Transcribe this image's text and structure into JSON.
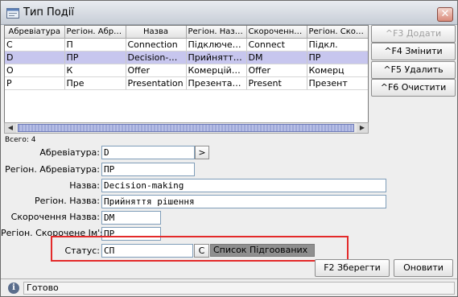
{
  "window": {
    "title": "Тип Події"
  },
  "table": {
    "columns": [
      "Абревіатура",
      "Регіон. Абреві...",
      "Назва",
      "Регіон. Назва",
      "Скорочення ...",
      "Регіон. Скоро..."
    ],
    "rows": [
      [
        "С",
        "П",
        "Connection",
        "Підключення",
        "Connect",
        "Підкл."
      ],
      [
        "D",
        "ПР",
        "Decision-ma...",
        "Прийняття ...",
        "DM",
        "ПР"
      ],
      [
        "O",
        "К",
        "Offer",
        "Комерційна ...",
        "Offer",
        "Комерц"
      ],
      [
        "P",
        "Пре",
        "Presentation",
        "Презентаці...",
        "Present",
        "Презент"
      ]
    ],
    "selected_row": 1,
    "total_label": "Всего: 4"
  },
  "side_buttons": {
    "add": "^F3 Додати",
    "edit": "^F4 Змінити",
    "delete": "^F5 Удалить",
    "clear": "^F6 Очистити"
  },
  "form": {
    "abbr_label": "Абревіатура:",
    "abbr_value": "D",
    "abbr_button": ">",
    "region_abbr_label": "Регіон. Абревіатура:",
    "region_abbr_value": "ПР",
    "name_label": "Назва:",
    "name_value": "Decision-making",
    "region_name_label": "Регіон. Назва:",
    "region_name_value": "Прийняття рішення",
    "short_name_label": "Скорочення Назва:",
    "short_name_value": "DM",
    "region_short_label": "Регіон. Скорочене Ім'я:",
    "region_short_value": "ПР",
    "status_label": "Статус:",
    "status_value": "СП",
    "status_button": "С",
    "status_name": "Список Підгоованих"
  },
  "bottom_buttons": {
    "save": "F2 Зберегти",
    "refresh": "Оновити"
  },
  "statusbar": {
    "text": "Готово"
  }
}
